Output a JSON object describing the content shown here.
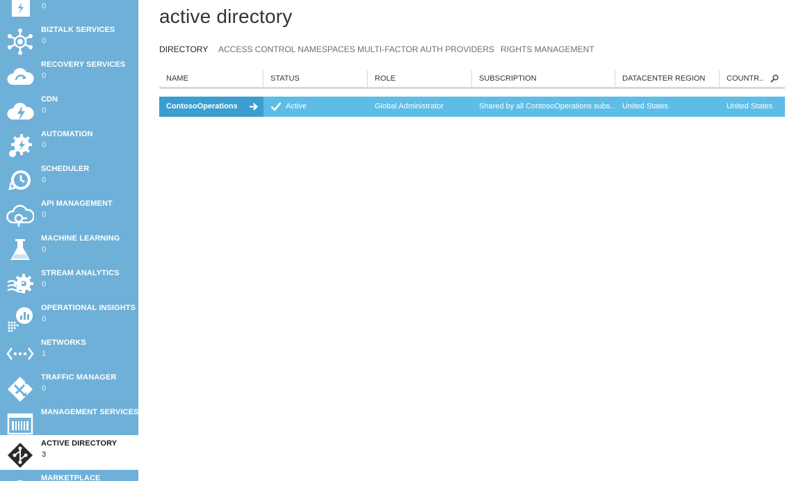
{
  "sidebar": {
    "items": [
      {
        "label": "",
        "count": "0",
        "icon": "storage-icon"
      },
      {
        "label": "BIZTALK SERVICES",
        "count": "0",
        "icon": "biztalk-icon"
      },
      {
        "label": "RECOVERY SERVICES",
        "count": "0",
        "icon": "recovery-cloud-icon"
      },
      {
        "label": "CDN",
        "count": "0",
        "icon": "cdn-cloud-icon"
      },
      {
        "label": "AUTOMATION",
        "count": "0",
        "icon": "automation-gear-icon"
      },
      {
        "label": "SCHEDULER",
        "count": "0",
        "icon": "scheduler-clock-icon"
      },
      {
        "label": "API MANAGEMENT",
        "count": "0",
        "icon": "api-cloud-icon"
      },
      {
        "label": "MACHINE LEARNING",
        "count": "0",
        "icon": "flask-icon"
      },
      {
        "label": "STREAM ANALYTICS",
        "count": "0",
        "icon": "stream-gear-icon"
      },
      {
        "label": "OPERATIONAL INSIGHTS",
        "count": "0",
        "icon": "insights-chart-icon"
      },
      {
        "label": "NETWORKS",
        "count": "1",
        "icon": "network-icon"
      },
      {
        "label": "TRAFFIC MANAGER",
        "count": "0",
        "icon": "traffic-manager-icon"
      },
      {
        "label": "MANAGEMENT SERVICES",
        "count": "",
        "icon": "management-services-icon"
      },
      {
        "label": "ACTIVE DIRECTORY",
        "count": "3",
        "icon": "active-directory-icon"
      },
      {
        "label": "MARKETPLACE",
        "count": "",
        "icon": "marketplace-icon"
      }
    ]
  },
  "main": {
    "title": "active directory",
    "tabs": [
      {
        "label": "DIRECTORY"
      },
      {
        "label": "ACCESS CONTROL NAMESPACES"
      },
      {
        "label": "MULTI-FACTOR AUTH PROVIDERS"
      },
      {
        "label": "RIGHTS MANAGEMENT"
      }
    ],
    "columns": [
      "NAME",
      "STATUS",
      "ROLE",
      "SUBSCRIPTION",
      "DATACENTER REGION",
      "COUNTR..."
    ],
    "rows": [
      {
        "name": "ContosoOperations",
        "status": "Active",
        "role": "Global Administrator",
        "subscription": "Shared by all ContosoOperations subs...",
        "region": "United States",
        "country": "United States"
      }
    ]
  },
  "colors": {
    "sidebar_bg": "#6fb0d8",
    "row_bg": "#5dbde6",
    "name_cell_bg": "#3a9ed0"
  }
}
